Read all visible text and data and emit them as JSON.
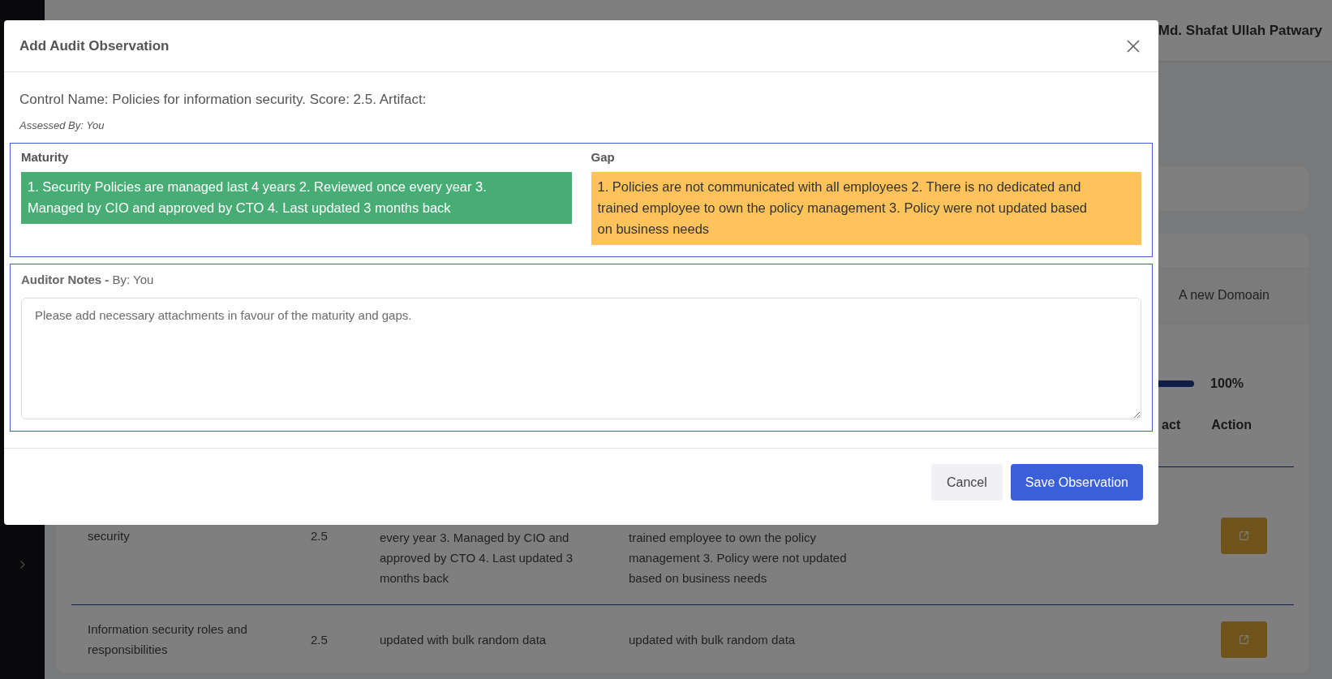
{
  "header": {
    "user_name": "Md. Shafat Ullah Patwary"
  },
  "tabs": [
    {
      "label": "A new Domoain",
      "selected": false
    }
  ],
  "progress": {
    "level": 1,
    "reading": "100%"
  },
  "table": {
    "columns": [
      "act",
      "Action"
    ],
    "rows": [
      {
        "cells": [
          "security",
          "2.5",
          "every year 3. Managed by CIO and approved by CTO 4. Last updated 3 months back",
          "trained employee to own the policy management 3. Policy were not updated based on business needs"
        ]
      },
      {
        "cells": [
          "Information security roles and responsibilities",
          "2.5",
          "updated with bulk random data",
          "updated with bulk random data"
        ]
      }
    ]
  },
  "modal": {
    "title": "Add Audit Observation",
    "control_line": "Control Name: Policies for information security. Score: 2.5. Artifact:",
    "assessed_by": "Assessed By: You",
    "maturity": {
      "label": "Maturity",
      "text": "1. Security Policies are managed last 4 years 2. Reviewed once every year 3. Managed by CIO and approved by CTO 4. Last updated 3 months back",
      "color": "#47ad74"
    },
    "gap": {
      "label": "Gap",
      "text": "1. Policies are not communicated with all employees 2. There is no dedicated and trained employee to own the policy management 3. Policy were not updated based on business needs",
      "color": "#ffc35c"
    },
    "notes": {
      "label": "**Auditor Notes -** By: You",
      "placeholder": "Please add necessary attachments in favour of the maturity and gaps."
    },
    "buttons": [
      {
        "label": "Cancel",
        "kind": "secondary"
      },
      {
        "label": "Save Observation",
        "kind": "primary"
      }
    ]
  }
}
